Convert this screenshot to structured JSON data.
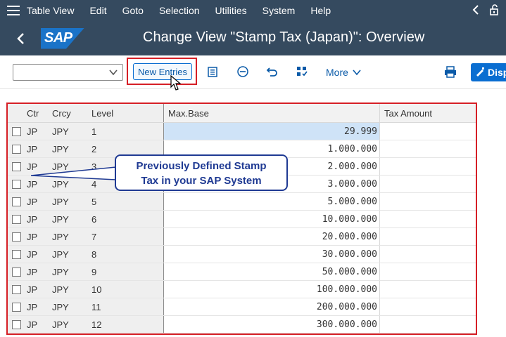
{
  "menu": {
    "items": [
      {
        "label": "Table View",
        "name": "menu-table-view"
      },
      {
        "label": "Edit",
        "name": "menu-edit"
      },
      {
        "label": "Goto",
        "name": "menu-goto"
      },
      {
        "label": "Selection",
        "name": "menu-selection"
      },
      {
        "label": "Utilities",
        "name": "menu-utilities"
      },
      {
        "label": "System",
        "name": "menu-system"
      },
      {
        "label": "Help",
        "name": "menu-help"
      }
    ]
  },
  "header": {
    "logo": "SAP",
    "title": "Change View \"Stamp Tax (Japan)\": Overview"
  },
  "toolbar": {
    "new_entries_label": "New Entries",
    "more_label": "More",
    "disp_label": "Disp"
  },
  "table": {
    "columns": [
      "Ctr",
      "Crcy",
      "Level",
      "Max.Base",
      "Tax Amount"
    ],
    "rows": [
      {
        "ctr": "JP",
        "crcy": "JPY",
        "level": "1",
        "max_base": "29.999",
        "tax_amount": ""
      },
      {
        "ctr": "JP",
        "crcy": "JPY",
        "level": "2",
        "max_base": "1.000.000",
        "tax_amount": ""
      },
      {
        "ctr": "JP",
        "crcy": "JPY",
        "level": "3",
        "max_base": "2.000.000",
        "tax_amount": ""
      },
      {
        "ctr": "JP",
        "crcy": "JPY",
        "level": "4",
        "max_base": "3.000.000",
        "tax_amount": ""
      },
      {
        "ctr": "JP",
        "crcy": "JPY",
        "level": "5",
        "max_base": "5.000.000",
        "tax_amount": ""
      },
      {
        "ctr": "JP",
        "crcy": "JPY",
        "level": "6",
        "max_base": "10.000.000",
        "tax_amount": ""
      },
      {
        "ctr": "JP",
        "crcy": "JPY",
        "level": "7",
        "max_base": "20.000.000",
        "tax_amount": ""
      },
      {
        "ctr": "JP",
        "crcy": "JPY",
        "level": "8",
        "max_base": "30.000.000",
        "tax_amount": ""
      },
      {
        "ctr": "JP",
        "crcy": "JPY",
        "level": "9",
        "max_base": "50.000.000",
        "tax_amount": ""
      },
      {
        "ctr": "JP",
        "crcy": "JPY",
        "level": "10",
        "max_base": "100.000.000",
        "tax_amount": ""
      },
      {
        "ctr": "JP",
        "crcy": "JPY",
        "level": "11",
        "max_base": "200.000.000",
        "tax_amount": ""
      },
      {
        "ctr": "JP",
        "crcy": "JPY",
        "level": "12",
        "max_base": "300.000.000",
        "tax_amount": ""
      }
    ]
  },
  "callout": {
    "line1": "Previously Defined Stamp",
    "line2": "Tax in your SAP System"
  },
  "colors": {
    "shell": "#354a5f",
    "accent": "#0a6ed1",
    "highlight_box": "#d61f26",
    "callout": "#1f3a93"
  }
}
